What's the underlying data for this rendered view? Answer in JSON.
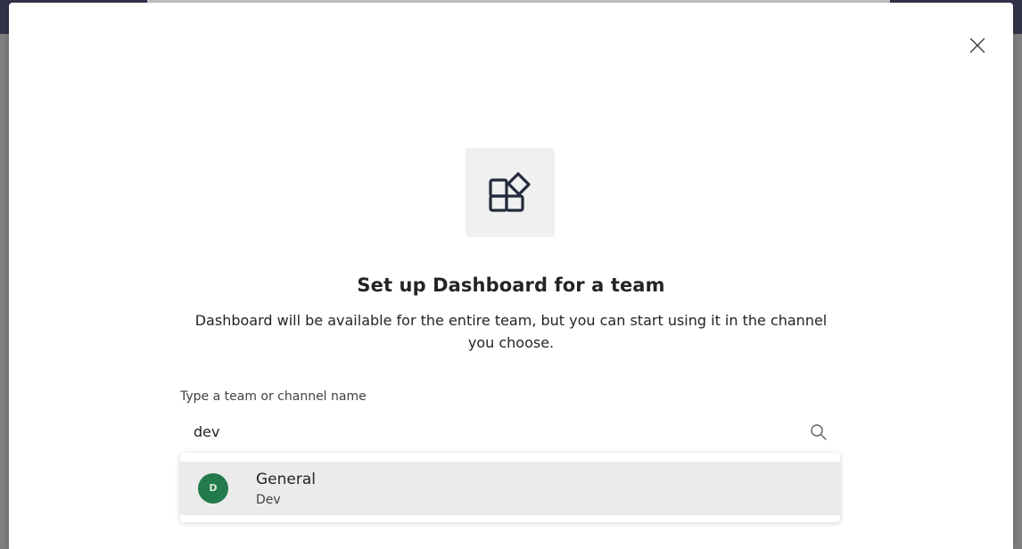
{
  "dialog": {
    "title": "Set up Dashboard for a team",
    "description": "Dashboard will be available for the entire team, but you can start using it in the channel you choose.",
    "app_icon": "apps-add-in-icon",
    "close_icon": "close-icon"
  },
  "search": {
    "label": "Type a team or channel name",
    "value": "dev",
    "icon": "search-icon"
  },
  "results": [
    {
      "avatar_initial": "D",
      "avatar_color": "#237b4b",
      "channel": "General",
      "team": "Dev"
    }
  ],
  "colors": {
    "topbar": "#33344a",
    "overlay": "#818181",
    "text": "#242424",
    "hover_row": "#ebebeb"
  }
}
